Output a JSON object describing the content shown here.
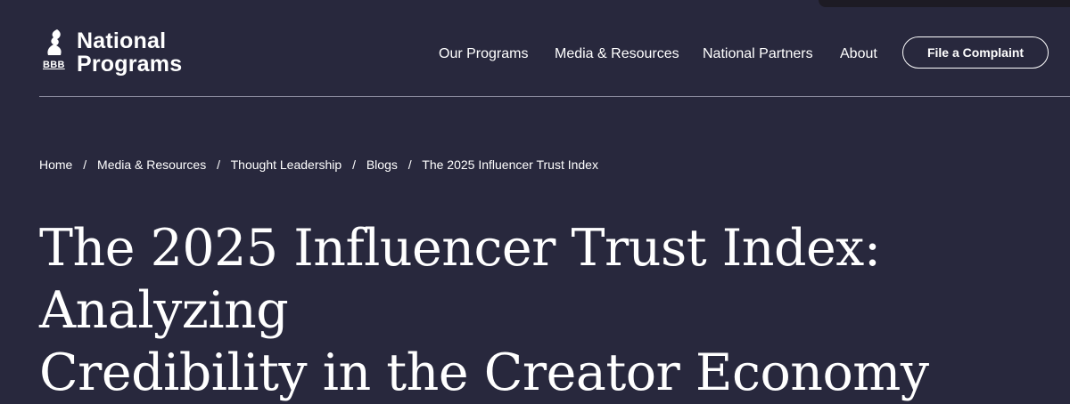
{
  "header": {
    "logo": {
      "badge": "BBB",
      "line1": "National",
      "line2": "Programs",
      "icon": "bbb-torch-icon"
    },
    "nav": [
      {
        "label": "Our Programs"
      },
      {
        "label": "Media & Resources"
      },
      {
        "label": "National Partners"
      },
      {
        "label": "About"
      }
    ],
    "cta_label": "File a Complaint"
  },
  "breadcrumb": {
    "separator": "/",
    "items": [
      {
        "label": "Home"
      },
      {
        "label": "Media & Resources"
      },
      {
        "label": "Thought Leadership"
      },
      {
        "label": "Blogs"
      },
      {
        "label": "The 2025 Influencer Trust Index"
      }
    ]
  },
  "page": {
    "title_line1": "The 2025 Influencer Trust Index: Analyzing",
    "title_line2": "Credibility in the Creator Economy"
  },
  "colors": {
    "background": "#28283d",
    "text": "#ffffff",
    "divider": "#8e8ea1"
  }
}
